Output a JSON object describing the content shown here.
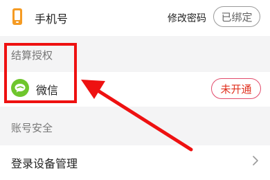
{
  "phone_row": {
    "label": "手机号",
    "change_password": "修改密码",
    "status": "已绑定",
    "icon": "phone-icon",
    "icon_color": "#f59b23"
  },
  "settlement_section": {
    "title": "结算授权"
  },
  "wechat_row": {
    "label": "微信",
    "status": "未开通",
    "icon": "wechat-icon",
    "icon_color": "#6fc62d"
  },
  "security_section": {
    "title": "账号安全"
  },
  "device_row": {
    "label": "登录设备管理",
    "icon": "chevron-right-icon"
  },
  "colors": {
    "annotation": "#ee1111",
    "section_background": "#f4f4f5",
    "status_inactive_text": "#e0301e",
    "status_inactive_border": "#e24a6a",
    "status_bound_border": "#9a9a9a"
  }
}
